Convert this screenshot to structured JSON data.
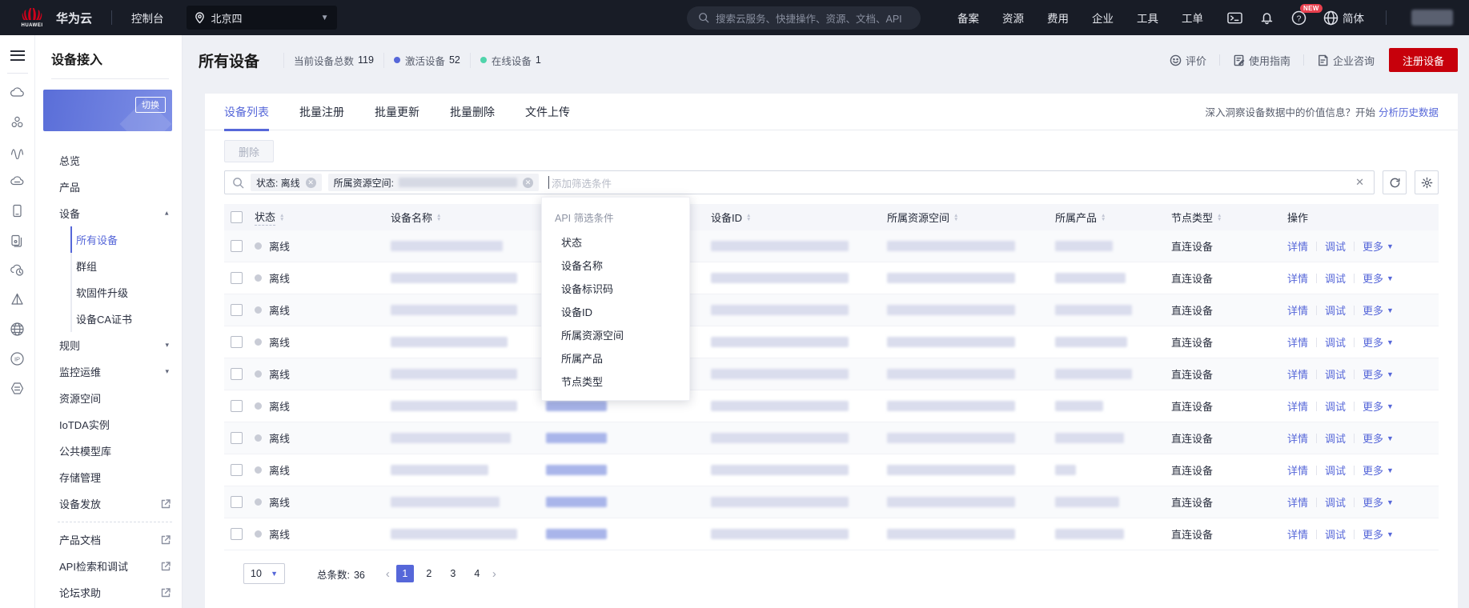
{
  "colors": {
    "accent": "#5667d9",
    "brand_red": "#c7000b",
    "online_green": "#50d4ab",
    "activated_blue": "#5667d9",
    "offline_dot": "#c9ccd6"
  },
  "topnav": {
    "logo": "HUAWEI",
    "brand": "华为云",
    "console": "控制台",
    "region": "北京四",
    "search_placeholder": "搜索云服务、快捷操作、资源、文档、API",
    "links": [
      {
        "label": "备案"
      },
      {
        "label": "资源"
      },
      {
        "label": "费用"
      },
      {
        "label": "企业"
      },
      {
        "label": "工具"
      },
      {
        "label": "工单"
      }
    ],
    "new_badge": "NEW",
    "language": "简体"
  },
  "rail_icons": [
    "cloud-icon",
    "cluster-icon",
    "wave-icon",
    "cloud-server-icon",
    "tablet-device-icon",
    "devices-icon",
    "cloud-clock-icon",
    "prism-icon",
    "globe-grid-icon",
    "ip-icon",
    "hexagon-flow-icon"
  ],
  "sidebar": {
    "title": "设备接入",
    "card_switch": "切换",
    "items": [
      {
        "label": "总览"
      },
      {
        "label": "产品"
      },
      {
        "label": "设备",
        "group": true,
        "expanded": true
      },
      {
        "label": "所有设备",
        "sub": true,
        "active": true
      },
      {
        "label": "群组",
        "sub": true
      },
      {
        "label": "软固件升级",
        "sub": true
      },
      {
        "label": "设备CA证书",
        "sub": true
      },
      {
        "label": "规则",
        "group": true
      },
      {
        "label": "监控运维",
        "group": true
      },
      {
        "label": "资源空间"
      },
      {
        "label": "IoTDA实例"
      },
      {
        "label": "公共模型库"
      },
      {
        "label": "存储管理"
      },
      {
        "label": "设备发放",
        "external": true
      },
      {
        "divider": true
      },
      {
        "label": "产品文档",
        "external": true
      },
      {
        "label": "API检索和调试",
        "external": true
      },
      {
        "label": "论坛求助",
        "external": true
      }
    ]
  },
  "header": {
    "title": "所有设备",
    "stats": [
      {
        "label": "当前设备总数",
        "value": "119"
      },
      {
        "label": "激活设备",
        "value": "52",
        "dot_color": "#5667d9"
      },
      {
        "label": "在线设备",
        "value": "1",
        "dot_color": "#50d4ab"
      }
    ],
    "actions": {
      "feedback": "评价",
      "guide": "使用指南",
      "consult": "企业咨询",
      "register": "注册设备"
    }
  },
  "tabs": [
    {
      "label": "设备列表",
      "active": true
    },
    {
      "label": "批量注册"
    },
    {
      "label": "批量更新"
    },
    {
      "label": "批量删除"
    },
    {
      "label": "文件上传"
    }
  ],
  "insight": {
    "text": "深入洞察设备数据中的价值信息？开始",
    "link": "分析历史数据"
  },
  "toolbar": {
    "delete": "删除"
  },
  "filter": {
    "tags": [
      {
        "label": "状态: 离线"
      },
      {
        "label": "所属资源空间:",
        "blurred": true
      }
    ],
    "placeholder": "添加筛选条件",
    "clear": "✕"
  },
  "dropdown": {
    "title": "API 筛选条件",
    "items": [
      {
        "label": "状态"
      },
      {
        "label": "设备名称"
      },
      {
        "label": "设备标识码"
      },
      {
        "label": "设备ID"
      },
      {
        "label": "所属资源空间"
      },
      {
        "label": "所属产品"
      },
      {
        "label": "节点类型"
      }
    ]
  },
  "table": {
    "columns": [
      {
        "label": ""
      },
      {
        "label": "状态",
        "sortable": true
      },
      {
        "label": "设备名称",
        "sortable": true
      },
      {
        "label": ""
      },
      {
        "label": "设备ID",
        "sortable": true
      },
      {
        "label": "所属资源空间",
        "sortable": true
      },
      {
        "label": "所属产品",
        "sortable": true
      },
      {
        "label": "节点类型",
        "sortable": true
      },
      {
        "label": "操作"
      }
    ],
    "actions": {
      "detail": "详情",
      "debug": "调试",
      "more": "更多"
    },
    "rows": [
      {
        "status": "离线",
        "node_type": "直连设备"
      },
      {
        "status": "离线",
        "node_type": "直连设备"
      },
      {
        "status": "离线",
        "node_type": "直连设备"
      },
      {
        "status": "离线",
        "node_type": "直连设备"
      },
      {
        "status": "离线",
        "node_type": "直连设备"
      },
      {
        "status": "离线",
        "node_type": "直连设备"
      },
      {
        "status": "离线",
        "node_type": "直连设备"
      },
      {
        "status": "离线",
        "node_type": "直连设备"
      },
      {
        "status": "离线",
        "node_type": "直连设备"
      },
      {
        "status": "离线",
        "node_type": "直连设备"
      }
    ]
  },
  "pagination": {
    "page_size": "10",
    "total_label": "总条数:",
    "total": "36",
    "pages": [
      {
        "n": "1",
        "active": true
      },
      {
        "n": "2"
      },
      {
        "n": "3"
      },
      {
        "n": "4"
      }
    ]
  }
}
